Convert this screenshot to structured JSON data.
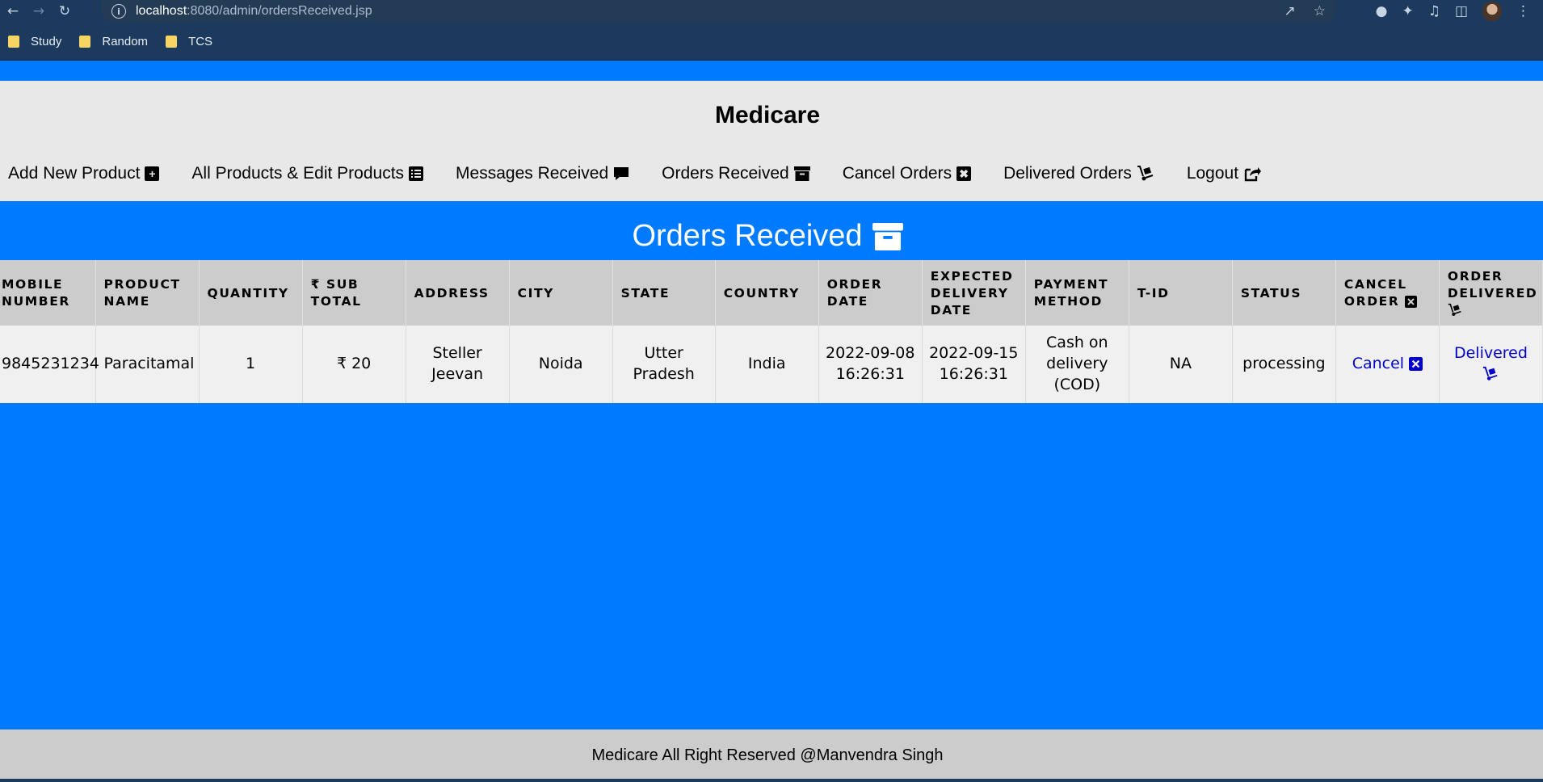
{
  "browser": {
    "url_host": "localhost",
    "url_path": ":8080/admin/ordersReceived.jsp",
    "bookmarks": [
      {
        "label": "Study",
        "icon": "folder-icon"
      },
      {
        "label": "Random",
        "icon": "folder-icon"
      },
      {
        "label": "TCS",
        "icon": "folder-icon"
      }
    ]
  },
  "header": {
    "title": "Medicare"
  },
  "nav": {
    "items": [
      {
        "label": "Add New Product",
        "icon": "plus-square-icon"
      },
      {
        "label": "All Products & Edit Products",
        "icon": "list-icon"
      },
      {
        "label": "Messages Received",
        "icon": "comment-icon"
      },
      {
        "label": "Orders Received",
        "icon": "archive-icon"
      },
      {
        "label": "Cancel Orders",
        "icon": "x-square-icon"
      },
      {
        "label": "Delivered Orders",
        "icon": "dolly-icon"
      },
      {
        "label": "Logout",
        "icon": "share-out-icon"
      }
    ]
  },
  "section": {
    "title": "Orders Received",
    "icon": "archive-icon"
  },
  "table": {
    "columns": [
      "MOBILE NUMBER",
      "PRODUCT NAME",
      "QUANTITY",
      "₹ SUB TOTAL",
      "ADDRESS",
      "CITY",
      "STATE",
      "COUNTRY",
      "ORDER DATE",
      "EXPECTED DELIVERY DATE",
      "PAYMENT METHOD",
      "T-ID",
      "STATUS",
      "CANCEL ORDER",
      "ORDER DELIVERED"
    ],
    "rows": [
      {
        "mobile": "9845231234",
        "product": "Paracitamal",
        "quantity": "1",
        "subtotal": "₹ 20",
        "address": "Steller Jeevan",
        "city": "Noida",
        "state": "Utter Pradesh",
        "country": "India",
        "order_date": "2022-09-08 16:26:31",
        "expected_date": "2022-09-15 16:26:31",
        "payment": "Cash on delivery (COD)",
        "tid": "NA",
        "status": "processing",
        "cancel_label": "Cancel",
        "delivered_label": "Delivered"
      }
    ]
  },
  "footer": {
    "text": "Medicare All Right Reserved @Manvendra Singh"
  },
  "colors": {
    "page_blue": "#007bff",
    "header_gray": "#e8e8e8",
    "table_header": "#cccccc",
    "link": "#0000cc"
  }
}
